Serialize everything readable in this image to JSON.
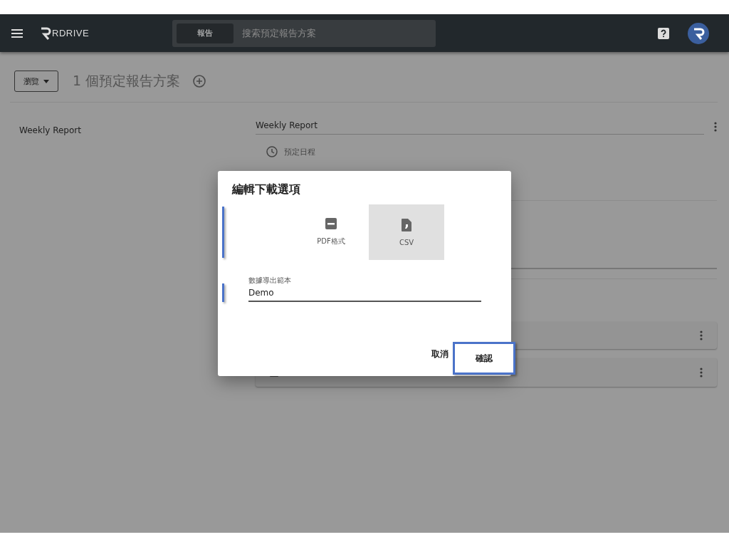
{
  "header": {
    "logo_text": "RDRIVE",
    "search_scope": "報告",
    "search_placeholder": "搜索預定報告方案"
  },
  "toolbar": {
    "view_button": "瀏覽",
    "title": "1 個預定報告方案"
  },
  "report_list": [
    {
      "name": "Weekly Report"
    }
  ],
  "detail": {
    "name_value": "Weekly Report",
    "schedule_label": "預定日程"
  },
  "dialog": {
    "title": "編輯下載選項",
    "format_picker_highlighted": true,
    "formats": [
      {
        "kind": "pdf",
        "label": "PDF格式",
        "selected": false
      },
      {
        "kind": "csv",
        "label": "CSV",
        "selected": true
      }
    ],
    "template_field": {
      "label": "數據導出範本",
      "value": "Demo",
      "highlighted": true
    },
    "buttons": [
      {
        "label": "取消",
        "highlighted": false
      },
      {
        "label": "確認",
        "highlighted": true
      }
    ]
  }
}
